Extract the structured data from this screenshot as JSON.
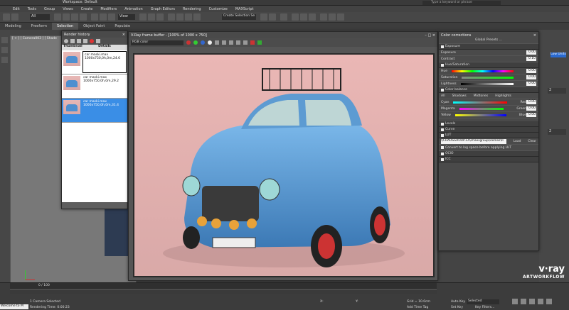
{
  "app": {
    "workspace": "Workspace: Default",
    "help_search": "Type a keyword or phrase"
  },
  "menu": [
    "Edit",
    "Tools",
    "Group",
    "Views",
    "Create",
    "Modifiers",
    "Animation",
    "Graph Editors",
    "Rendering",
    "Customize",
    "MAXScript"
  ],
  "toolbar": {
    "filter": "All",
    "view": "View",
    "selection_set": "Create Selection Se"
  },
  "ribbon": [
    "Modeling",
    "Freeform",
    "Selection",
    "Object Paint",
    "Populate"
  ],
  "viewport_label": "[ + ] [ Camera003 ] [ Shade",
  "render_history": {
    "title": "Render history",
    "col_thumb": "Thumbnail",
    "col_details": "Details",
    "items": [
      {
        "index": "1",
        "file": "car maski.max",
        "info": "1000x750,0h,0m,24.6"
      },
      {
        "index": "2",
        "file": "car maski.max",
        "info": "1000x750,0h,0m,29.2"
      },
      {
        "index": "3",
        "file": "car maski.max",
        "info": "1000x750,0h,0m,31.4"
      }
    ]
  },
  "vfb": {
    "title": "V-Ray frame buffer - [100% of 1000 x 750]",
    "channel": "RGB color"
  },
  "cc": {
    "title": "Color corrections",
    "global_presets": "Global Presets ...",
    "exposure": {
      "label": "Exposure",
      "exposure": "Exposure",
      "exposure_val": "0.00",
      "contrast": "Contrast",
      "contrast_val": "0.10"
    },
    "huesat": {
      "label": "Hue/Saturation",
      "hue": "Hue",
      "hue_val": "0.00",
      "sat": "Saturation",
      "sat_val": "0.00",
      "light": "Lightness",
      "light_val": "0.00"
    },
    "cb": {
      "label": "Color balance",
      "all": "All",
      "shadows": "Shadows",
      "midtones": "Midtones",
      "highlights": "Highlights",
      "cyan": "Cyan",
      "red": "Red",
      "cr_val": "0.00",
      "magenta": "Magenta",
      "green": "Green",
      "mg_val": "0.00",
      "yellow": "Yellow",
      "blue": "Blue",
      "yb_val": "0.00"
    },
    "levels": "Levels",
    "curve": "Curve",
    "lut": "LUT",
    "lut_path": "\\\\CHAOSGROUP-LA\\chaosgroup\\Demos\\R",
    "load": "Load",
    "clear": "Clear",
    "convert": "Convert to log space before applying LUT",
    "ocio": "OCIO",
    "icc": "ICC"
  },
  "right": {
    "lw_units": "Low Units",
    "v1": "2",
    "v2": "2"
  },
  "status": {
    "frame": "0 / 100",
    "selected": "1 Camera Selected",
    "render_time": "Rendering Time: 0:00:23",
    "welcome": "Welcome to M",
    "grid": "Grid = 10.0cm",
    "autokey": "Auto Key",
    "selected_mode": "Selected",
    "setkey": "Set Key",
    "keyfilters": "Key Filters...",
    "addtime": "Add Time Tag",
    "x": "X:",
    "y": "Y:"
  },
  "logo": {
    "brand": "v·ray",
    "sub": "ARTWORKFLOW"
  }
}
